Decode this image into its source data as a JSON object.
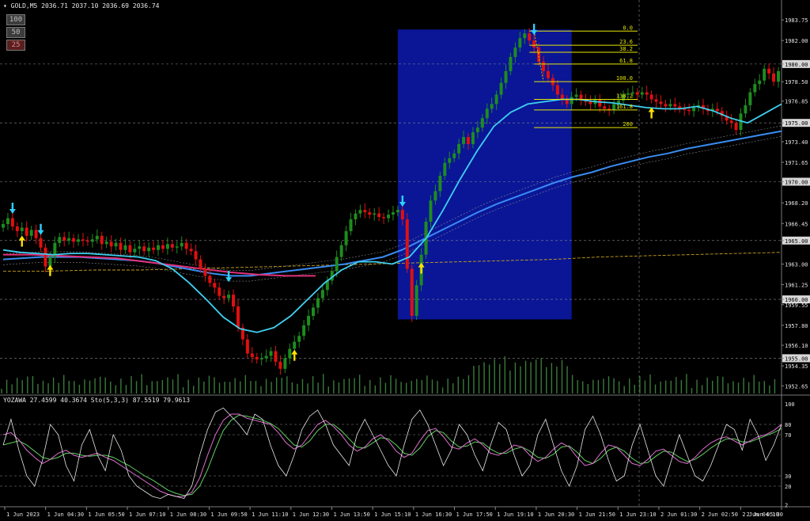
{
  "header": {
    "symbol_line": "GOLD,M5  2036.71 2037.10 2036.69 2036.74",
    "indicator_line": "YOZAWA 27.4599 40.3674  Sto(5,3,3) 87.5519 79.9613"
  },
  "timeframe_buttons": [
    "100",
    "50",
    "25"
  ],
  "colors": {
    "background": "#000000",
    "bull_candle": "#1e8c1e",
    "bear_candle": "#e01010",
    "fast_ma": "#3fd0f0",
    "slow_ma": "#3a8cf0",
    "magenta_ma": "#e0307a",
    "fib_line": "#e6e600",
    "highlight_box": "#0a1696",
    "volume": "#3a7a3a",
    "grid": "#8a8a8a",
    "stoch_main": "#e8e8e8",
    "stoch_signal_k": "#e070d0",
    "stoch_signal_d": "#60d060"
  },
  "chart_data": {
    "type": "line",
    "instrument": "GOLD",
    "timeframe": "M5",
    "price_axis_labels": [
      "1983.75",
      "1982.00",
      "1980.00",
      "1978.50",
      "1976.85",
      "1975.00",
      "1973.40",
      "1971.65",
      "1970.00",
      "1968.20",
      "1966.45",
      "1965.00",
      "1963.00",
      "1961.25",
      "1960.00",
      "1959.55",
      "1957.80",
      "1956.10",
      "1955.00",
      "1954.35",
      "1952.65"
    ],
    "highlighted_price_labels": [
      "1980.00",
      "1975.00",
      "1970.00",
      "1965.00",
      "1960.00",
      "1955.00"
    ],
    "time_axis_labels": [
      "1 Jun 2023",
      "1 Jun 04:30",
      "1 Jun 05:50",
      "1 Jun 07:10",
      "1 Jun 08:30",
      "1 Jun 09:50",
      "1 Jun 11:10",
      "1 Jun 12:30",
      "1 Jun 13:50",
      "1 Jun 15:10",
      "1 Jun 16:30",
      "1 Jun 17:50",
      "1 Jun 19:10",
      "1 Jun 20:30",
      "1 Jun 21:50",
      "1 Jun 23:10",
      "2 Jun 01:30",
      "2 Jun 02:50",
      "2 Jun 04:10",
      "2 Jun 05:30"
    ],
    "price_range": [
      1952.0,
      1984.5
    ],
    "close_prices": [
      1966.4,
      1966.9,
      1966.2,
      1965.8,
      1966.1,
      1965.4,
      1965.9,
      1965.2,
      1964.4,
      1962.8,
      1963.6,
      1964.8,
      1965.3,
      1965.0,
      1965.2,
      1964.9,
      1965.1,
      1965.0,
      1964.9,
      1965.1,
      1965.4,
      1964.7,
      1964.9,
      1964.5,
      1964.8,
      1964.2,
      1964.6,
      1964.0,
      1964.3,
      1964.5,
      1964.1,
      1964.4,
      1964.2,
      1964.6,
      1964.3,
      1964.7,
      1964.4,
      1964.5,
      1964.8,
      1964.3,
      1964.1,
      1963.4,
      1962.6,
      1962.0,
      1961.4,
      1961.0,
      1960.3,
      1960.1,
      1960.4,
      1959.4,
      1957.6,
      1956.6,
      1955.4,
      1955.1,
      1954.9,
      1955.0,
      1955.2,
      1955.6,
      1954.7,
      1954.1,
      1955.0,
      1955.8,
      1956.4,
      1956.9,
      1957.8,
      1958.6,
      1959.3,
      1960.1,
      1960.8,
      1961.6,
      1962.4,
      1963.6,
      1964.6,
      1965.8,
      1966.8,
      1967.3,
      1967.6,
      1967.4,
      1967.2,
      1967.3,
      1967.0,
      1966.9,
      1967.2,
      1967.4,
      1967.6,
      1966.8,
      1962.6,
      1958.6,
      1961.2,
      1963.8,
      1966.6,
      1968.4,
      1969.2,
      1970.5,
      1971.6,
      1972.0,
      1972.4,
      1973.2,
      1973.8,
      1973.2,
      1974.2,
      1974.6,
      1975.4,
      1976.2,
      1976.6,
      1977.4,
      1978.4,
      1979.4,
      1980.6,
      1981.4,
      1982.2,
      1982.6,
      1982.0,
      1981.4,
      1980.2,
      1979.4,
      1978.8,
      1978.2,
      1977.4,
      1977.0,
      1976.6,
      1977.2,
      1977.4,
      1977.0,
      1976.8,
      1976.6,
      1977.0,
      1976.4,
      1976.2,
      1976.1,
      1976.6,
      1976.9,
      1977.4,
      1977.5,
      1977.6,
      1977.4,
      1977.6,
      1977.4,
      1977.0,
      1976.8,
      1976.6,
      1976.4,
      1976.6,
      1976.4,
      1976.2,
      1976.1,
      1976.0,
      1976.3,
      1976.5,
      1976.2,
      1976.0,
      1976.2,
      1976.0,
      1975.6,
      1975.2,
      1975.0,
      1974.4,
      1975.8,
      1976.5,
      1977.6,
      1978.3,
      1978.6,
      1979.6,
      1979.2,
      1978.5,
      1979.4
    ],
    "fast_ma": [
      1964.2,
      1964.0,
      1963.9,
      1963.8,
      1963.9,
      1963.9,
      1963.8,
      1963.7,
      1963.6,
      1963.3,
      1962.6,
      1961.4,
      1960.0,
      1958.5,
      1957.5,
      1957.2,
      1957.6,
      1958.6,
      1960.0,
      1961.4,
      1962.5,
      1963.2,
      1963.2,
      1963.0,
      1963.6,
      1965.2,
      1967.6,
      1970.2,
      1972.6,
      1974.7,
      1975.9,
      1976.6,
      1976.8,
      1977.0,
      1977.0,
      1976.8,
      1976.7,
      1976.5,
      1976.3,
      1976.2,
      1976.2,
      1976.4,
      1976.0,
      1975.4,
      1975.0,
      1975.8,
      1976.6
    ],
    "slow_ma": [
      1963.4,
      1963.5,
      1963.6,
      1963.6,
      1963.6,
      1963.5,
      1963.4,
      1963.3,
      1963.1,
      1962.8,
      1962.5,
      1962.2,
      1962.0,
      1962.0,
      1962.2,
      1962.4,
      1962.6,
      1962.8,
      1963.0,
      1963.3,
      1963.6,
      1964.2,
      1965.0,
      1965.8,
      1966.6,
      1967.4,
      1968.1,
      1968.7,
      1969.3,
      1969.9,
      1970.4,
      1970.8,
      1971.3,
      1971.7,
      1972.1,
      1972.4,
      1972.8,
      1973.1,
      1973.4,
      1973.7,
      1974.0,
      1974.3
    ],
    "magenta_ma": [
      1963.8,
      1963.8,
      1963.7,
      1963.6,
      1963.5,
      1963.2,
      1962.9,
      1962.6,
      1962.3,
      1962.1,
      1962.0,
      1962.0
    ],
    "yellow_ma": [
      1962.4,
      1962.4,
      1962.5,
      1962.5,
      1962.6,
      1962.7,
      1962.8,
      1962.9,
      1963.0,
      1963.1,
      1963.2,
      1963.3,
      1963.4,
      1963.6,
      1963.7,
      1963.8,
      1963.9,
      1964.0
    ],
    "fib_levels": [
      {
        "label": "0.0",
        "price": 1982.8
      },
      {
        "label": "23.6",
        "price": 1981.6
      },
      {
        "label": "38.2",
        "price": 1981.0
      },
      {
        "label": "61.8",
        "price": 1980.0
      },
      {
        "label": "100.0",
        "price": 1978.5
      },
      {
        "label": "138.2",
        "price": 1977.0
      },
      {
        "label": "161.8",
        "price": 1976.1
      },
      {
        "label": "200",
        "price": 1974.6
      }
    ],
    "signals": [
      {
        "type": "down",
        "bar": 2
      },
      {
        "type": "up",
        "bar": 4
      },
      {
        "type": "down",
        "bar": 8
      },
      {
        "type": "up",
        "bar": 10
      },
      {
        "type": "down",
        "bar": 48
      },
      {
        "type": "up",
        "bar": 62
      },
      {
        "type": "down",
        "bar": 85
      },
      {
        "type": "up",
        "bar": 89
      },
      {
        "type": "down",
        "bar": 113
      },
      {
        "type": "up",
        "bar": 138
      }
    ],
    "stochastic": {
      "levels": [
        100,
        80,
        70,
        30,
        20,
        2
      ],
      "main": [
        60,
        85,
        55,
        30,
        20,
        45,
        80,
        70,
        40,
        25,
        60,
        75,
        50,
        35,
        70,
        55,
        30,
        20,
        15,
        10,
        8,
        12,
        10,
        8,
        20,
        50,
        75,
        92,
        96,
        88,
        80,
        70,
        90,
        85,
        60,
        40,
        30,
        50,
        75,
        88,
        94,
        80,
        60,
        50,
        40,
        70,
        85,
        70,
        55,
        40,
        30,
        60,
        85,
        94,
        80,
        60,
        40,
        55,
        80,
        70,
        50,
        35,
        60,
        82,
        75,
        50,
        30,
        40,
        70,
        85,
        60,
        35,
        20,
        40,
        75,
        88,
        70,
        45,
        25,
        30,
        60,
        80,
        55,
        30,
        20,
        45,
        70,
        50,
        30,
        25,
        40,
        60,
        80,
        75,
        55,
        85,
        70,
        45,
        60,
        80
      ],
      "k": [
        70,
        72,
        65,
        55,
        48,
        42,
        46,
        52,
        55,
        50,
        48,
        50,
        52,
        48,
        45,
        40,
        35,
        30,
        25,
        20,
        15,
        12,
        10,
        10,
        14,
        28,
        50,
        70,
        84,
        90,
        90,
        86,
        84,
        82,
        80,
        72,
        62,
        56,
        60,
        70,
        80,
        84,
        78,
        70,
        60,
        54,
        58,
        66,
        70,
        64,
        54,
        48,
        52,
        64,
        74,
        76,
        68,
        58,
        56,
        62,
        66,
        60,
        52,
        50,
        54,
        60,
        58,
        50,
        44,
        48,
        56,
        62,
        58,
        48,
        40,
        42,
        52,
        60,
        58,
        50,
        42,
        40,
        46,
        54,
        56,
        50,
        44,
        42,
        48,
        56,
        62,
        66,
        68,
        64,
        60,
        64,
        68,
        70,
        74,
        80
      ],
      "d": [
        60,
        62,
        64,
        60,
        54,
        48,
        46,
        48,
        52,
        52,
        50,
        49,
        50,
        50,
        48,
        44,
        40,
        35,
        30,
        26,
        21,
        16,
        13,
        11,
        12,
        20,
        36,
        56,
        74,
        84,
        89,
        88,
        86,
        84,
        81,
        76,
        68,
        60,
        58,
        64,
        74,
        80,
        80,
        74,
        66,
        58,
        57,
        62,
        67,
        66,
        60,
        52,
        50,
        57,
        68,
        74,
        72,
        64,
        58,
        59,
        63,
        62,
        56,
        52,
        52,
        56,
        58,
        54,
        48,
        47,
        51,
        58,
        59,
        53,
        45,
        42,
        47,
        55,
        58,
        54,
        47,
        42,
        43,
        49,
        54,
        53,
        48,
        44,
        46,
        51,
        57,
        62,
        66,
        66,
        63,
        63,
        66,
        69,
        72,
        76
      ]
    }
  }
}
